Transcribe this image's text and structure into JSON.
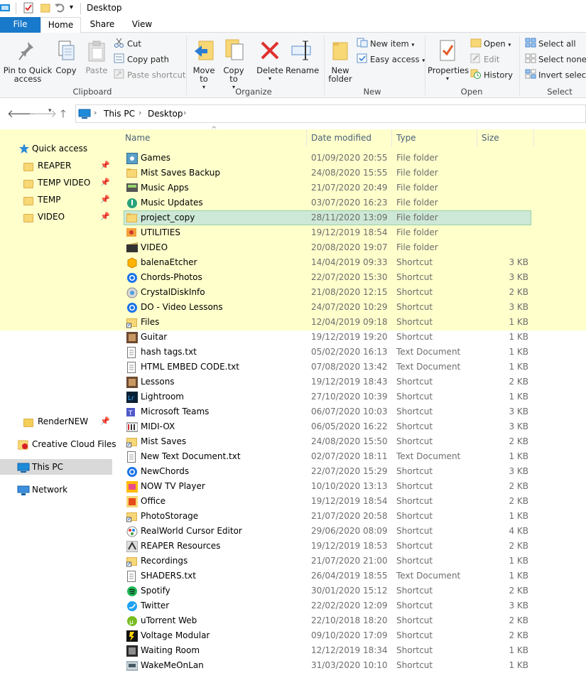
{
  "window": {
    "title": "Desktop"
  },
  "tabs": {
    "file": "File",
    "home": "Home",
    "share": "Share",
    "view": "View"
  },
  "ribbon": {
    "clipboard": {
      "label": "Clipboard",
      "pin_to_quick_access": "Pin to Quick access",
      "copy": "Copy",
      "paste": "Paste",
      "cut": "Cut",
      "copy_path": "Copy path",
      "paste_shortcut": "Paste shortcut"
    },
    "organize": {
      "label": "Organize",
      "move_to": "Move to",
      "copy_to": "Copy to",
      "delete": "Delete",
      "rename": "Rename"
    },
    "new": {
      "label": "New",
      "new_folder": "New folder",
      "new_item": "New item",
      "easy_access": "Easy access"
    },
    "open": {
      "label": "Open",
      "properties": "Properties",
      "open": "Open",
      "edit": "Edit",
      "history": "History"
    },
    "select": {
      "label": "Select",
      "select_all": "Select all",
      "select_none": "Select none",
      "invert_selection": "Invert selection"
    }
  },
  "address": {
    "crumbs": [
      "This PC",
      "Desktop"
    ]
  },
  "navpane": {
    "quick_access": "Quick access",
    "pinned": [
      "REAPER",
      "TEMP VIDEO",
      "TEMP",
      "VIDEO"
    ],
    "render_new": "RenderNEW",
    "creative_cloud": "Creative Cloud Files",
    "this_pc": "This PC",
    "network": "Network"
  },
  "columns": {
    "name": "Name",
    "date": "Date modified",
    "type": "Type",
    "size": "Size"
  },
  "files": [
    {
      "name": "Games",
      "date": "01/09/2020 20:55",
      "type": "File folder",
      "size": "",
      "icon": "games-folder-icon"
    },
    {
      "name": "Mist Saves Backup",
      "date": "24/08/2020 15:55",
      "type": "File folder",
      "size": "",
      "icon": "folder-icon"
    },
    {
      "name": "Music Apps",
      "date": "21/07/2020 20:49",
      "type": "File folder",
      "size": "",
      "icon": "music-apps-folder-icon"
    },
    {
      "name": "Music Updates",
      "date": "03/07/2020 16:23",
      "type": "File folder",
      "size": "",
      "icon": "music-updates-folder-icon"
    },
    {
      "name": "project_copy",
      "date": "28/11/2020 13:09",
      "type": "File folder",
      "size": "",
      "icon": "folder-icon"
    },
    {
      "name": "UTILITIES",
      "date": "19/12/2019 18:54",
      "type": "File folder",
      "size": "",
      "icon": "utilities-folder-icon"
    },
    {
      "name": "VIDEO",
      "date": "20/08/2020 19:07",
      "type": "File folder",
      "size": "",
      "icon": "video-folder-icon"
    },
    {
      "name": "balenaEtcher",
      "date": "14/04/2019 09:33",
      "type": "Shortcut",
      "size": "3 KB",
      "icon": "balena-etcher-icon"
    },
    {
      "name": "Chords-Photos",
      "date": "22/07/2020 15:30",
      "type": "Shortcut",
      "size": "3 KB",
      "icon": "chrome-app-icon"
    },
    {
      "name": "CrystalDiskInfo",
      "date": "21/08/2020 12:15",
      "type": "Shortcut",
      "size": "2 KB",
      "icon": "crystal-disk-info-icon"
    },
    {
      "name": "DO - Video Lessons",
      "date": "24/07/2020 10:29",
      "type": "Shortcut",
      "size": "3 KB",
      "icon": "chrome-app-icon"
    },
    {
      "name": "Files",
      "date": "12/04/2019 09:18",
      "type": "Shortcut",
      "size": "1 KB",
      "icon": "folder-shortcut-icon"
    },
    {
      "name": "Guitar",
      "date": "19/12/2019 19:20",
      "type": "Shortcut",
      "size": "1 KB",
      "icon": "guitar-shortcut-icon"
    },
    {
      "name": "hash tags.txt",
      "date": "05/02/2020 16:13",
      "type": "Text Document",
      "size": "1 KB",
      "icon": "text-document-icon"
    },
    {
      "name": "HTML EMBED CODE.txt",
      "date": "07/08/2020 13:42",
      "type": "Text Document",
      "size": "1 KB",
      "icon": "text-document-icon"
    },
    {
      "name": "Lessons",
      "date": "19/12/2019 18:43",
      "type": "Shortcut",
      "size": "2 KB",
      "icon": "lessons-shortcut-icon"
    },
    {
      "name": "Lightroom",
      "date": "27/10/2020 10:39",
      "type": "Shortcut",
      "size": "1 KB",
      "icon": "lightroom-icon"
    },
    {
      "name": "Microsoft Teams",
      "date": "06/07/2020 10:03",
      "type": "Shortcut",
      "size": "3 KB",
      "icon": "teams-icon"
    },
    {
      "name": "MIDI-OX",
      "date": "06/05/2020 16:22",
      "type": "Shortcut",
      "size": "3 KB",
      "icon": "midi-ox-icon"
    },
    {
      "name": "Mist Saves",
      "date": "24/08/2020 15:50",
      "type": "Shortcut",
      "size": "2 KB",
      "icon": "folder-shortcut-icon"
    },
    {
      "name": "New Text Document.txt",
      "date": "02/07/2020 18:11",
      "type": "Text Document",
      "size": "1 KB",
      "icon": "text-document-icon"
    },
    {
      "name": "NewChords",
      "date": "22/07/2020 15:29",
      "type": "Shortcut",
      "size": "3 KB",
      "icon": "chrome-app-icon"
    },
    {
      "name": "NOW TV Player",
      "date": "10/10/2020 13:13",
      "type": "Shortcut",
      "size": "2 KB",
      "icon": "now-tv-icon"
    },
    {
      "name": "Office",
      "date": "19/12/2019 18:54",
      "type": "Shortcut",
      "size": "2 KB",
      "icon": "office-icon"
    },
    {
      "name": "PhotoStorage",
      "date": "21/07/2020 20:58",
      "type": "Shortcut",
      "size": "1 KB",
      "icon": "folder-shortcut-icon"
    },
    {
      "name": "RealWorld Cursor Editor",
      "date": "29/06/2020 08:09",
      "type": "Shortcut",
      "size": "4 KB",
      "icon": "cursor-editor-icon"
    },
    {
      "name": "REAPER Resources",
      "date": "19/12/2019 18:53",
      "type": "Shortcut",
      "size": "2 KB",
      "icon": "reaper-icon"
    },
    {
      "name": "Recordings",
      "date": "21/07/2020 21:00",
      "type": "Shortcut",
      "size": "1 KB",
      "icon": "folder-shortcut-icon"
    },
    {
      "name": "SHADERS.txt",
      "date": "26/04/2019 18:55",
      "type": "Text Document",
      "size": "1 KB",
      "icon": "text-document-icon"
    },
    {
      "name": "Spotify",
      "date": "30/01/2020 15:12",
      "type": "Shortcut",
      "size": "2 KB",
      "icon": "spotify-icon"
    },
    {
      "name": "Twitter",
      "date": "22/02/2020 12:09",
      "type": "Shortcut",
      "size": "3 KB",
      "icon": "twitter-icon"
    },
    {
      "name": "uTorrent Web",
      "date": "22/10/2018 18:20",
      "type": "Shortcut",
      "size": "2 KB",
      "icon": "utorrent-icon"
    },
    {
      "name": "Voltage Modular",
      "date": "09/10/2020 17:09",
      "type": "Shortcut",
      "size": "2 KB",
      "icon": "voltage-modular-icon"
    },
    {
      "name": "Waiting Room",
      "date": "12/12/2019 18:34",
      "type": "Shortcut",
      "size": "1 KB",
      "icon": "waiting-room-icon"
    },
    {
      "name": "WakeMeOnLan",
      "date": "31/03/2020 10:10",
      "type": "Shortcut",
      "size": "1 KB",
      "icon": "wake-me-on-lan-icon"
    }
  ],
  "selected_file": "project_copy",
  "colors": {
    "accent": "#1979ca",
    "highlight": "#ffffcc",
    "selection": "#cde8d6",
    "folder": "#f8d775"
  }
}
